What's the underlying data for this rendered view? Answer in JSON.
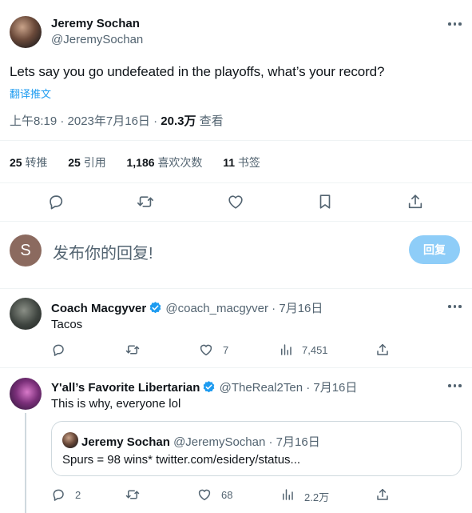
{
  "main_tweet": {
    "author_name": "Jeremy Sochan",
    "author_handle": "@JeremySochan",
    "text": "Lets say you go undefeated in the playoffs, what’s your record?",
    "translate_link": "翻译推文",
    "time": "上午8:19 · 2023年7月16日 · ",
    "views_count": "20.3万",
    "views_label": " 查看",
    "stats": {
      "retweets_count": "25",
      "retweets_label": "转推",
      "quotes_count": "25",
      "quotes_label": "引用",
      "likes_count": "1,186",
      "likes_label": "喜欢次数",
      "bookmarks_count": "11",
      "bookmarks_label": "书签"
    }
  },
  "composer": {
    "avatar_letter": "S",
    "placeholder": "发布你的回复!",
    "reply_button": "回复"
  },
  "replies": [
    {
      "author_name": "Coach Macgyver",
      "author_handle": "@coach_macgyver",
      "date": " · 7月16日",
      "text": "Tacos",
      "actions": {
        "reply": "",
        "retweet": "",
        "like": "7",
        "views": "7,451"
      }
    },
    {
      "author_name": "Y'all’s Favorite Libertarian",
      "author_handle": "@TheReal2Ten",
      "date": " · 7月16日",
      "text": "This is why, everyone lol",
      "quote": {
        "author_name": "Jeremy Sochan",
        "author_handle": "@JeremySochan",
        "date": " · 7月16日",
        "text": "Spurs = 98 wins* twitter.com/esidery/status..."
      },
      "actions": {
        "reply": "2",
        "retweet": "",
        "like": "68",
        "views": "2.2万"
      }
    }
  ],
  "colors": {
    "accent": "#1d9bf0",
    "reply_button_bg": "#8ecdf8",
    "muted_text": "#536471",
    "divider": "#eff3f4"
  }
}
